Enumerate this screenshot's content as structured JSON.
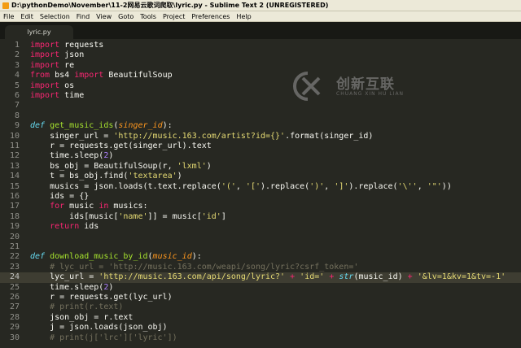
{
  "window": {
    "title": "D:\\pythonDemo\\November\\11-2网易云歌词爬取\\lyric.py - Sublime Text 2 (UNREGISTERED)"
  },
  "menu": [
    "File",
    "Edit",
    "Selection",
    "Find",
    "View",
    "Goto",
    "Tools",
    "Project",
    "Preferences",
    "Help"
  ],
  "tab": {
    "label": "lyric.py"
  },
  "watermark": {
    "name": "创新互联",
    "subtitle": "CHUANG XIN HU LIAN"
  },
  "editor": {
    "current_line": 24,
    "lines": [
      [
        [
          "k",
          "import"
        ],
        [
          "t",
          " requests"
        ]
      ],
      [
        [
          "k",
          "import"
        ],
        [
          "t",
          " json"
        ]
      ],
      [
        [
          "k",
          "import"
        ],
        [
          "t",
          " re"
        ]
      ],
      [
        [
          "k",
          "from"
        ],
        [
          "t",
          " bs4 "
        ],
        [
          "k",
          "import"
        ],
        [
          "t",
          " BeautifulSoup"
        ]
      ],
      [
        [
          "k",
          "import"
        ],
        [
          "t",
          " os"
        ]
      ],
      [
        [
          "k",
          "import"
        ],
        [
          "t",
          " time"
        ]
      ],
      [],
      [],
      [
        [
          "d",
          "def"
        ],
        [
          "t",
          " "
        ],
        [
          "f",
          "get_music_ids"
        ],
        [
          "t",
          "("
        ],
        [
          "p",
          "singer_id"
        ],
        [
          "t",
          "):"
        ]
      ],
      [
        [
          "t",
          "    singer_url = "
        ],
        [
          "s",
          "'http://music.163.com/artist?id={}'"
        ],
        [
          "t",
          ".format(singer_id)"
        ]
      ],
      [
        [
          "t",
          "    r = requests.get(singer_url).text"
        ]
      ],
      [
        [
          "t",
          "    time.sleep("
        ],
        [
          "n",
          "2"
        ],
        [
          "t",
          ")"
        ]
      ],
      [
        [
          "t",
          "    bs_obj = BeautifulSoup(r, "
        ],
        [
          "s",
          "'lxml'"
        ],
        [
          "t",
          ")"
        ]
      ],
      [
        [
          "t",
          "    t = bs_obj.find("
        ],
        [
          "s",
          "'textarea'"
        ],
        [
          "t",
          ")"
        ]
      ],
      [
        [
          "t",
          "    musics = json.loads(t.text.replace("
        ],
        [
          "s",
          "'('"
        ],
        [
          "t",
          ", "
        ],
        [
          "s",
          "'['"
        ],
        [
          "t",
          ").replace("
        ],
        [
          "s",
          "')'"
        ],
        [
          "t",
          ", "
        ],
        [
          "s",
          "']'"
        ],
        [
          "t",
          ").replace("
        ],
        [
          "s",
          "'\\''"
        ],
        [
          "t",
          ", "
        ],
        [
          "s",
          "'\"'"
        ],
        [
          "t",
          "))"
        ]
      ],
      [
        [
          "t",
          "    ids = {}"
        ]
      ],
      [
        [
          "t",
          "    "
        ],
        [
          "k",
          "for"
        ],
        [
          "t",
          " music "
        ],
        [
          "k",
          "in"
        ],
        [
          "t",
          " musics:"
        ]
      ],
      [
        [
          "t",
          "        ids[music["
        ],
        [
          "s",
          "'name'"
        ],
        [
          "t",
          "]] = music["
        ],
        [
          "s",
          "'id'"
        ],
        [
          "t",
          "]"
        ]
      ],
      [
        [
          "t",
          "    "
        ],
        [
          "k",
          "return"
        ],
        [
          "t",
          " ids"
        ]
      ],
      [],
      [],
      [
        [
          "d",
          "def"
        ],
        [
          "t",
          " "
        ],
        [
          "f",
          "download_music_by_id"
        ],
        [
          "t",
          "("
        ],
        [
          "p",
          "music_id"
        ],
        [
          "t",
          "):"
        ]
      ],
      [
        [
          "t",
          "    "
        ],
        [
          "c",
          "# lyc_url = 'http://music.163.com/weapi/song/lyric?csrf_token='"
        ]
      ],
      [
        [
          "t",
          "    lyc_url = "
        ],
        [
          "s",
          "'http://music.163.com/api/song/lyric?'"
        ],
        [
          "t",
          " "
        ],
        [
          "k",
          "+"
        ],
        [
          "t",
          " "
        ],
        [
          "s",
          "'id='"
        ],
        [
          "t",
          " "
        ],
        [
          "k",
          "+"
        ],
        [
          "t",
          " "
        ],
        [
          "b",
          "str"
        ],
        [
          "t",
          "(music_id) "
        ],
        [
          "k",
          "+"
        ],
        [
          "t",
          " "
        ],
        [
          "s",
          "'&lv=1&kv=1&tv=-1'"
        ]
      ],
      [
        [
          "t",
          "    time.sleep("
        ],
        [
          "n",
          "2"
        ],
        [
          "t",
          ")"
        ]
      ],
      [
        [
          "t",
          "    r = requests.get(lyc_url)"
        ]
      ],
      [
        [
          "t",
          "    "
        ],
        [
          "c",
          "# print(r.text)"
        ]
      ],
      [
        [
          "t",
          "    json_obj = r.text"
        ]
      ],
      [
        [
          "t",
          "    j = json.loads(json_obj)"
        ]
      ],
      [
        [
          "t",
          "    "
        ],
        [
          "c",
          "# print(j['lrc']['lyric'])"
        ]
      ]
    ]
  }
}
